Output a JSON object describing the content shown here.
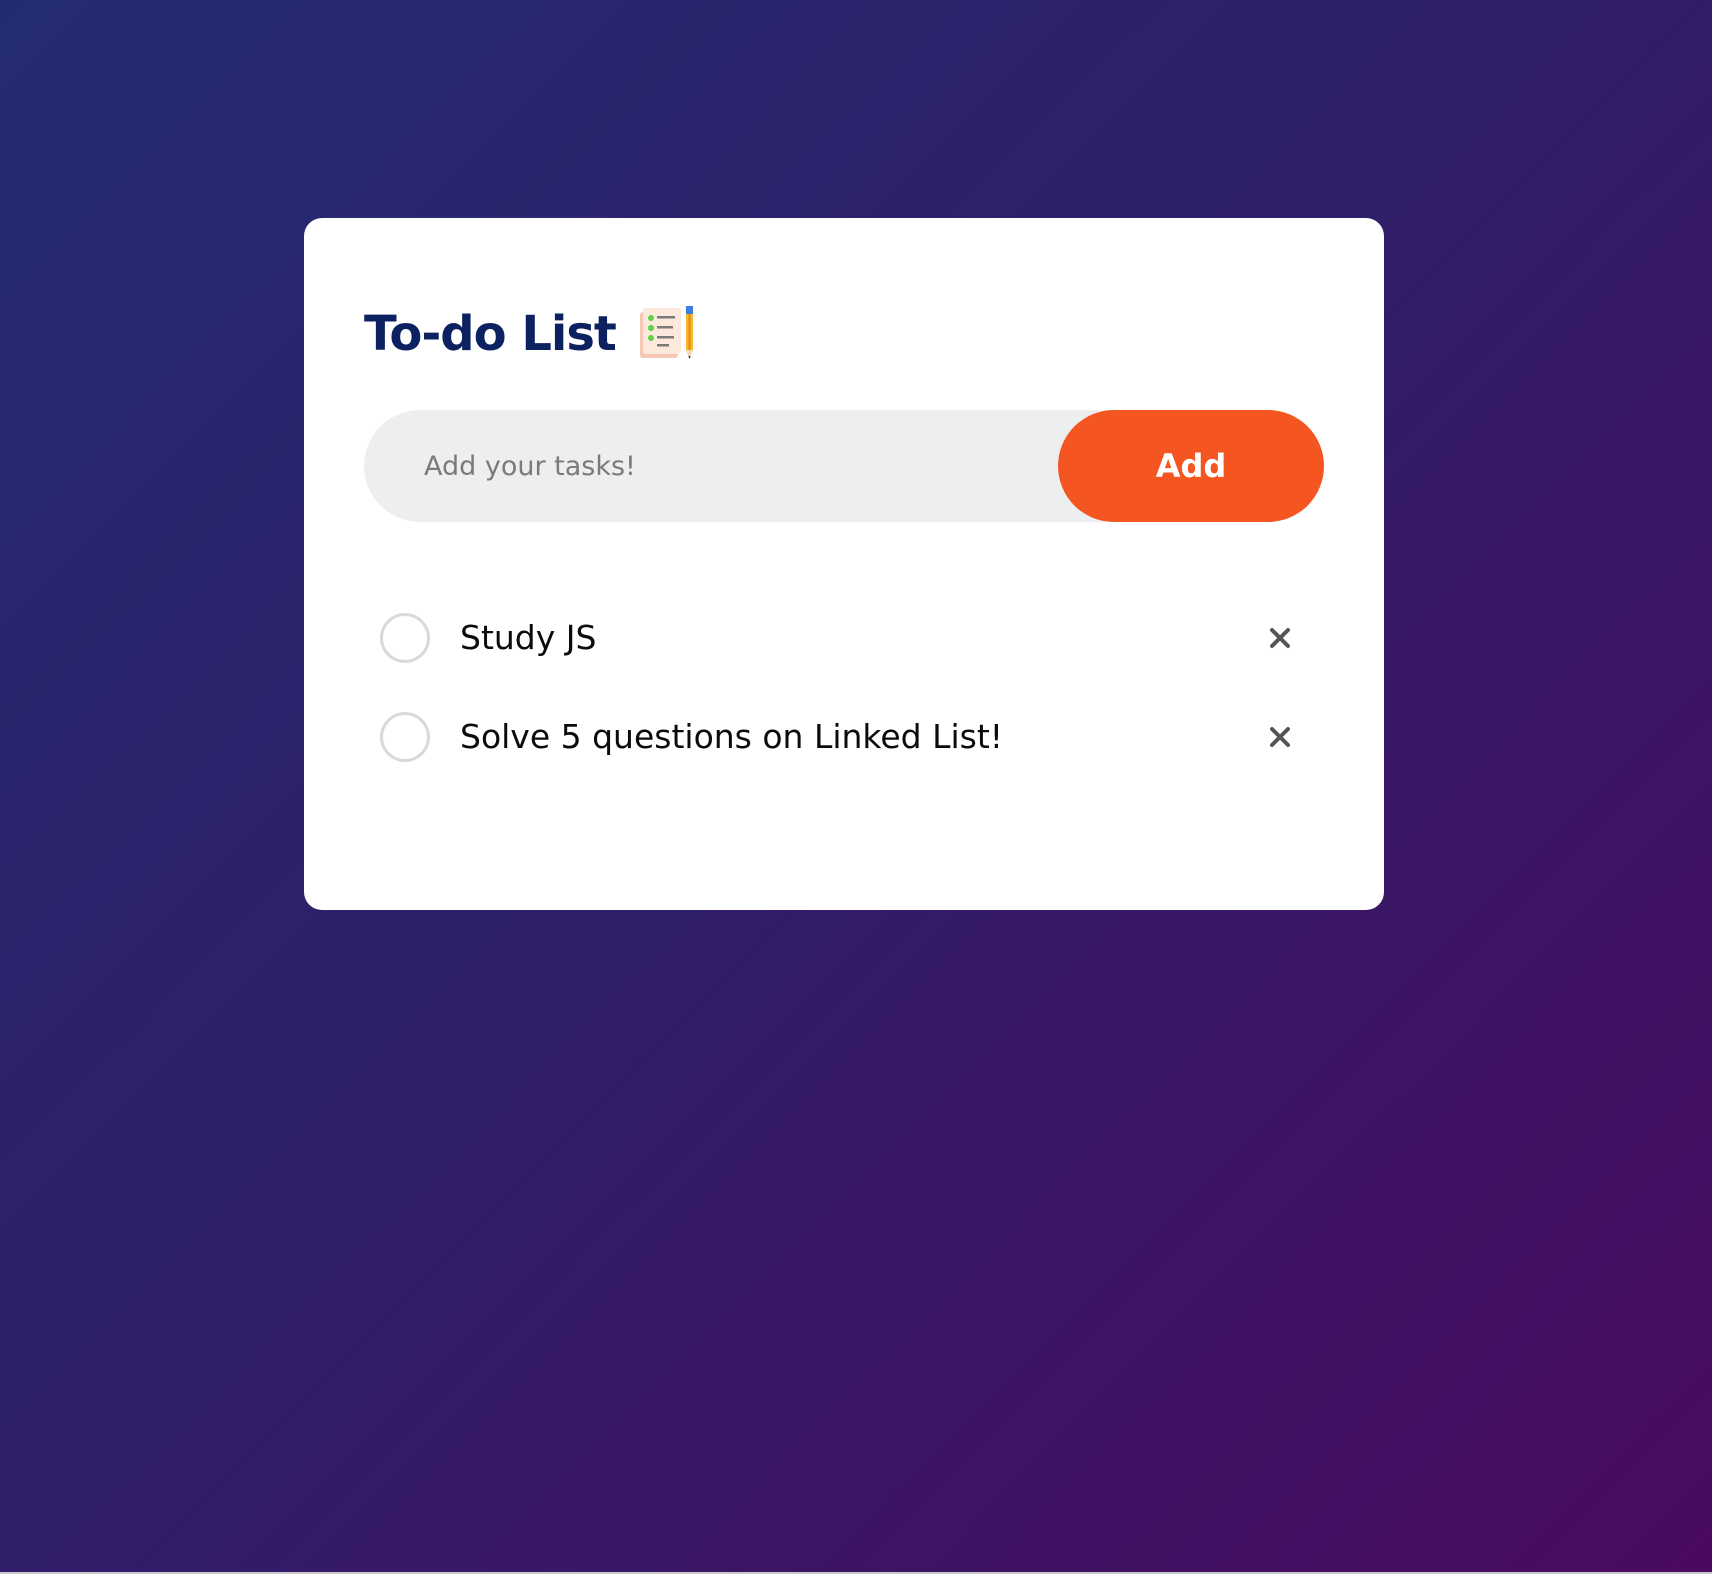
{
  "app": {
    "title": "To-do List",
    "title_icon": "notes-with-pencil-icon"
  },
  "input": {
    "placeholder": "Add your tasks!",
    "value": ""
  },
  "buttons": {
    "add_label": "Add"
  },
  "tasks": [
    {
      "text": "Study JS",
      "checked": false
    },
    {
      "text": "Solve 5 questions on Linked List!",
      "checked": false
    }
  ],
  "colors": {
    "accent": "#f55520",
    "title": "#0c2260",
    "background_start": "#232c72",
    "background_end": "#4a0a5f"
  }
}
